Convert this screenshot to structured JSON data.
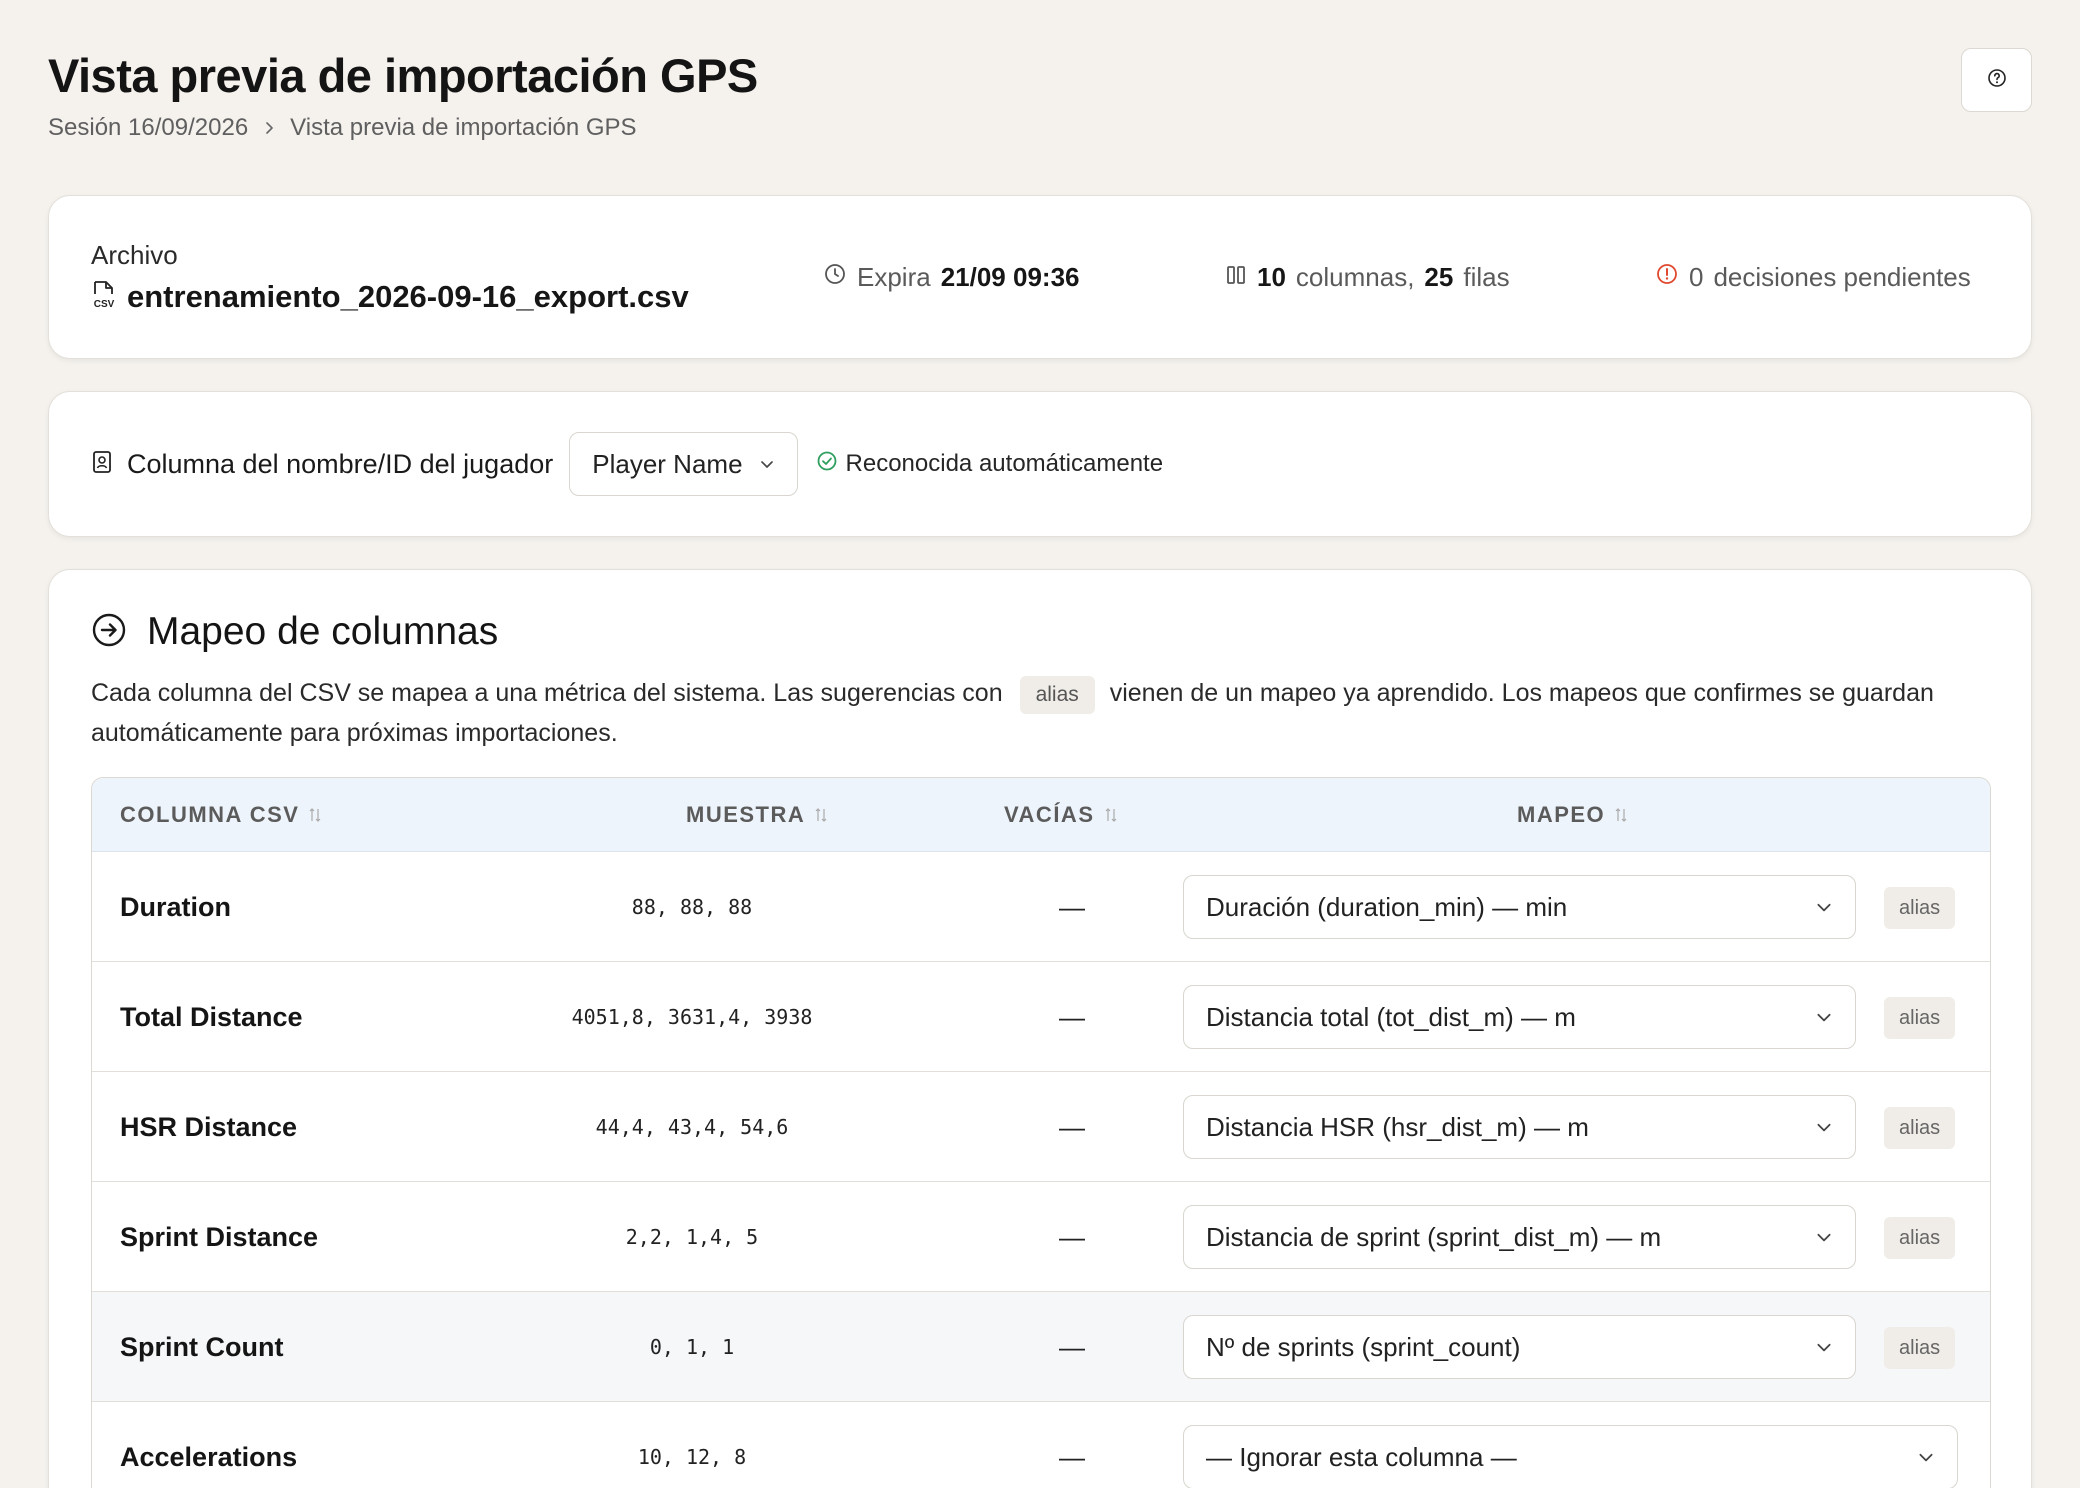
{
  "header": {
    "title": "Vista previa de importación GPS",
    "breadcrumb": [
      "Sesión 16/09/2026",
      "Vista previa de importación GPS"
    ]
  },
  "help_icon": "help-circle-icon",
  "file_card": {
    "label": "Archivo",
    "file_name": "entrenamiento_2026-09-16_export.csv",
    "expires_label": "Expira",
    "expires_value": "21/09 09:36",
    "columns_count": "10",
    "columns_label": "columnas,",
    "rows_count": "25",
    "rows_label": "filas",
    "pending_count": "0",
    "pending_label": "decisiones pendientes"
  },
  "player_card": {
    "label": "Columna del nombre/ID del jugador",
    "selected": "Player Name",
    "status": "Reconocida automáticamente"
  },
  "mapping": {
    "title": "Mapeo de columnas",
    "desc_before": "Cada columna del CSV se mapea a una métrica del sistema. Las sugerencias con",
    "desc_chip": "alias",
    "desc_after": "vienen de un mapeo ya aprendido. Los mapeos que confirmes se guardan automáticamente para próximas importaciones.",
    "headers": [
      "COLUMNA CSV",
      "MUESTRA",
      "VACÍAS",
      "MAPEO"
    ],
    "rows": [
      {
        "name": "Duration",
        "sample": "88, 88, 88",
        "empty": "—",
        "mapping": "Duración (duration_min) — min",
        "badge": "alias"
      },
      {
        "name": "Total Distance",
        "sample": "4051,8, 3631,4, 3938",
        "empty": "—",
        "mapping": "Distancia total (tot_dist_m) — m",
        "badge": "alias"
      },
      {
        "name": "HSR Distance",
        "sample": "44,4, 43,4, 54,6",
        "empty": "—",
        "mapping": "Distancia HSR (hsr_dist_m) — m",
        "badge": "alias"
      },
      {
        "name": "Sprint Distance",
        "sample": "2,2, 1,4, 5",
        "empty": "—",
        "mapping": "Distancia de sprint (sprint_dist_m) — m",
        "badge": "alias"
      },
      {
        "name": "Sprint Count",
        "sample": "0, 1, 1",
        "empty": "—",
        "mapping": "Nº de sprints (sprint_count)",
        "badge": "alias"
      },
      {
        "name": "Accelerations",
        "sample": "10, 12, 8",
        "empty": "—",
        "mapping": "— Ignorar esta columna —"
      }
    ]
  },
  "colors": {
    "background": "#f5f2ee",
    "header_row": "#eef4fb",
    "success": "#2f9e5f",
    "warning": "#e0492f"
  }
}
